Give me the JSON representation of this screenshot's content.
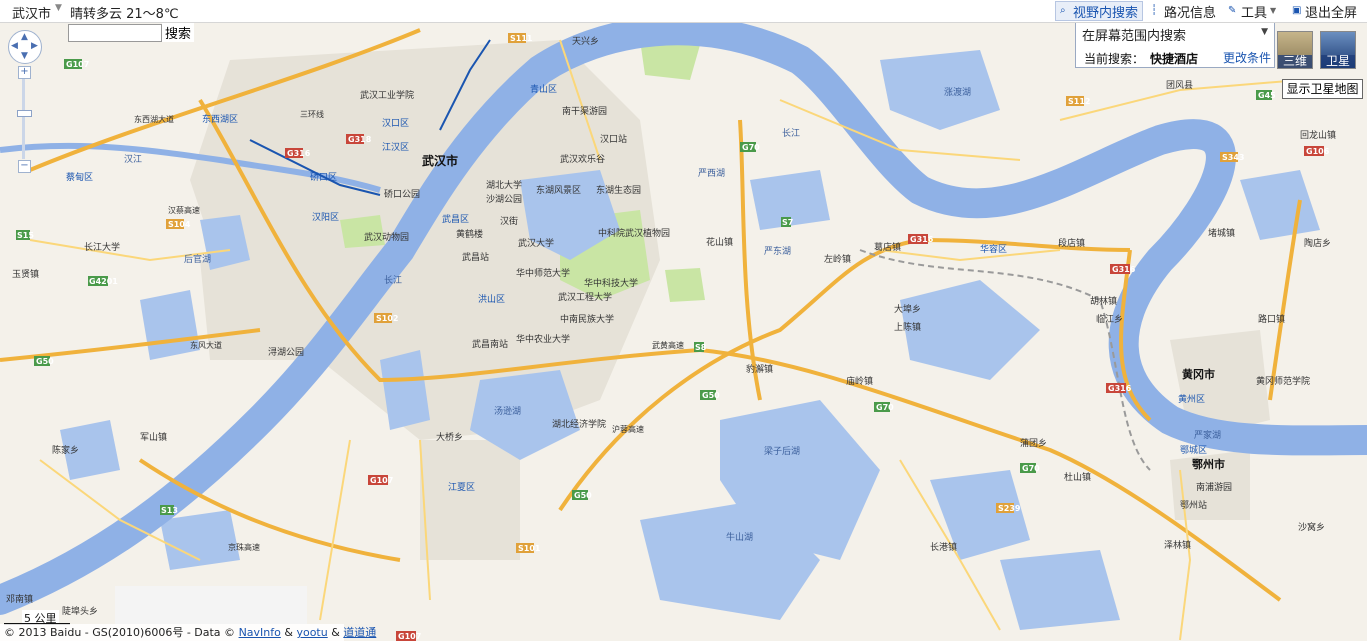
{
  "topbar": {
    "city": "武汉市",
    "weather": "晴转多云 21～8℃"
  },
  "toolbar": {
    "view_search": "视野内搜索",
    "traffic": "路况信息",
    "tools": "工具",
    "exit_fullscreen": "退出全屏"
  },
  "search": {
    "button": "搜索",
    "value": ""
  },
  "panel": {
    "scope": "在屏幕范围内搜索",
    "current_label": "当前搜索：",
    "current_value": "快捷酒店",
    "modify": "更改条件"
  },
  "map_types": {
    "three_d": "三维",
    "satellite": "卫星",
    "satellite_tip": "显示卫星地图"
  },
  "scale": "5 公里",
  "footer": {
    "copyright": "© 2013 Baidu - GS(2010)6006号 - Data ©",
    "navinfo": "NavInfo",
    "amp": "&",
    "yootu": "yootu",
    "daodao": "道道通"
  },
  "colors": {
    "land": "#f4f1ea",
    "water": "#a9c4ec",
    "river": "#8fb1e6",
    "highway": "#f0b23c",
    "road": "#fbd77a",
    "green": "#c9e5a4",
    "urban": "#e9e6df"
  },
  "map": {
    "districts": [
      "武汉市",
      "汉口区",
      "江汉区",
      "硚口区",
      "汉阳区",
      "武昌区",
      "洪山区",
      "青山区",
      "江夏区",
      "东西湖区",
      "蔡甸区",
      "汉南",
      "黄冈市",
      "黄州区",
      "鄂州市",
      "鄂城区"
    ],
    "places": [
      "天兴乡",
      "武汉工业学院",
      "南干渠游园",
      "湖北大学",
      "东湖风景区",
      "东湖生态园",
      "武汉欢乐谷",
      "沙湖公园",
      "汉街",
      "黄鹤楼",
      "武汉大学",
      "武昌站",
      "华中师范大学",
      "武汉工程大学",
      "华中科技大学",
      "中南民族大学",
      "华中农业大学",
      "湖北经济学院",
      "中科院武汉植物园",
      "武汉动物园",
      "长江大学",
      "汤逊湖",
      "梁子后湖",
      "牛山湖",
      "涨渡湖",
      "武昌南站",
      "汉口站",
      "武汉站",
      "鄂州站",
      "黄冈师范学院",
      "南浦游园",
      "团风县",
      "花山镇",
      "左岭镇",
      "葛店镇",
      "华容区",
      "段店镇",
      "大埠乡",
      "上陈镇",
      "庙岭镇",
      "豹澥镇",
      "蒲团乡",
      "杜山镇",
      "长港镇",
      "泽林镇",
      "沙窝乡",
      "大桥乡",
      "陈家乡",
      "军山镇",
      "玉贤镇",
      "邓南镇",
      "陡埠头乡",
      "胡林镇",
      "临江乡",
      "路口镇",
      "回龙山镇",
      "堵城镇",
      "陶店乡",
      "硚口公园",
      "浔湖公园",
      "东西湖大道",
      "汉蔡高速",
      "武黄高速",
      "京珠高速",
      "沪蓉高速",
      "东风大道",
      "三环线",
      "长江",
      "汉江",
      "严西湖",
      "后官湖",
      "严东湖",
      "严家湖"
    ],
    "highways": [
      "G107",
      "G316",
      "G318",
      "G4201",
      "G50",
      "G70",
      "G45",
      "G106",
      "S111",
      "S112",
      "S101",
      "S102",
      "S103",
      "S104",
      "S13",
      "S15",
      "S7",
      "S8",
      "S239",
      "S343"
    ]
  }
}
